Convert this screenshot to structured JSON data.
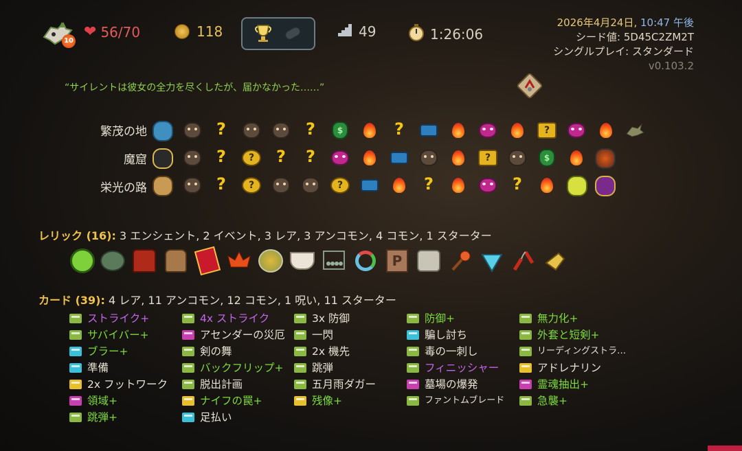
{
  "status": {
    "ascension": "10",
    "hp": "56/70",
    "gold": "118",
    "floor": "49",
    "time": "1:26:06"
  },
  "meta": {
    "date": "2026年4月24日,",
    "time": "10:47 午後",
    "seed": "シード値: 5D45C2ZM2T",
    "mode": "シングルプレイ: スタンダード",
    "version": "v0.103.2"
  },
  "quote": "“サイレントは彼女の全力を尽くしたが、届かなかった……”",
  "acts": [
    {
      "label": "繁茂の地"
    },
    {
      "label": "魔窟"
    },
    {
      "label": "栄光の路"
    }
  ],
  "relics": {
    "title": "レリック (16):",
    "summary": "3 エンシェント, 2 イベント, 3 レア, 3 アンコモン, 4 コモン, 1 スターター"
  },
  "cards": {
    "title": "カード (39):",
    "summary": "4 レア, 11 アンコモン, 12 コモン, 1 呪い, 11 スターター",
    "columns": [
      [
        "ストライク+",
        "サバイバー+",
        "ブラー+",
        "準備",
        "2x フットワーク",
        "領域+",
        "跳弾+"
      ],
      [
        "4x ストライク",
        "アセンダーの災厄",
        "剣の舞",
        "バックフリップ+",
        "脱出計画",
        "ナイフの罠+",
        "足払い"
      ],
      [
        "3x 防御",
        "一閃",
        "2x 機先",
        "跳弾",
        "五月雨ダガー",
        "残像+"
      ],
      [
        "防御+",
        "騙し討ち",
        "毒の一刺し",
        "フィニッシャー",
        "墓場の爆発",
        "ファントムブレード"
      ],
      [
        "無力化+",
        "外套と短剣+",
        "リーディングストラ…",
        "アドレナリン",
        "霊魂抽出+",
        "急襲+"
      ]
    ]
  },
  "colors": {
    "upgraded": "#7ddb3c",
    "rare": "#c466e8",
    "section": "#f0c24b",
    "hp": "#e45a5a",
    "gold": "#e8c060"
  }
}
